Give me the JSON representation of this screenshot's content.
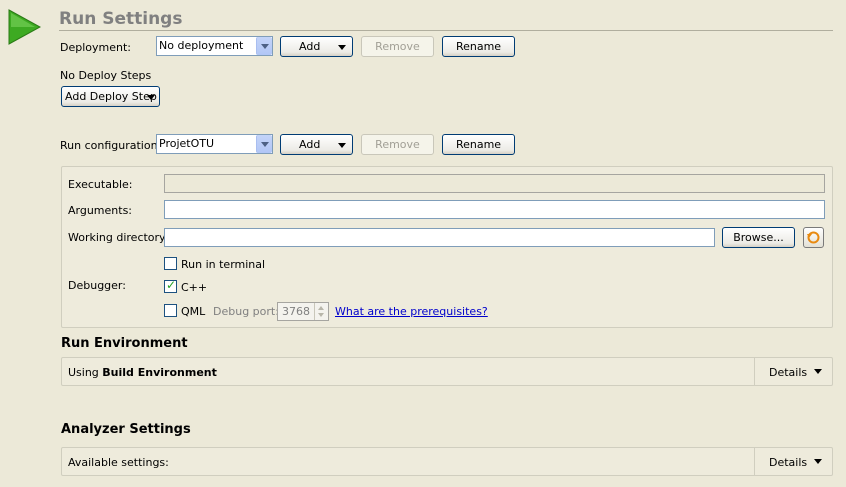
{
  "header": {
    "title": "Run Settings"
  },
  "deployment": {
    "label": "Deployment:",
    "selected": "No deployment",
    "add_label": "Add",
    "remove_label": "Remove",
    "rename_label": "Rename",
    "steps_text": "No Deploy Steps",
    "add_step_label": "Add Deploy Step"
  },
  "run_configuration": {
    "label": "Run configuration:",
    "selected": "ProjetOTU",
    "add_label": "Add",
    "remove_label": "Remove",
    "rename_label": "Rename"
  },
  "run_panel": {
    "executable_label": "Executable:",
    "executable_value": "",
    "arguments_label": "Arguments:",
    "arguments_value": "",
    "working_dir_label": "Working directory:",
    "working_dir_value": "",
    "browse_label": "Browse...",
    "run_in_terminal_label": "Run in terminal",
    "run_in_terminal_checked": false,
    "debugger_label": "Debugger:",
    "cpp_label": "C++",
    "cpp_checked": true,
    "qml_label": "QML",
    "qml_checked": false,
    "debug_port_label": "Debug port:",
    "debug_port_value": "3768",
    "prereq_link": "What are the prerequisites?"
  },
  "run_environment": {
    "title": "Run Environment",
    "using_prefix": "Using ",
    "using_bold": "Build Environment",
    "details_label": "Details"
  },
  "analyzer_settings": {
    "title": "Analyzer Settings",
    "available_label": "Available settings:",
    "details_label": "Details"
  },
  "colors": {
    "play_icon": "#3DAA22",
    "link": "#0000CC",
    "check": "#21A121"
  }
}
